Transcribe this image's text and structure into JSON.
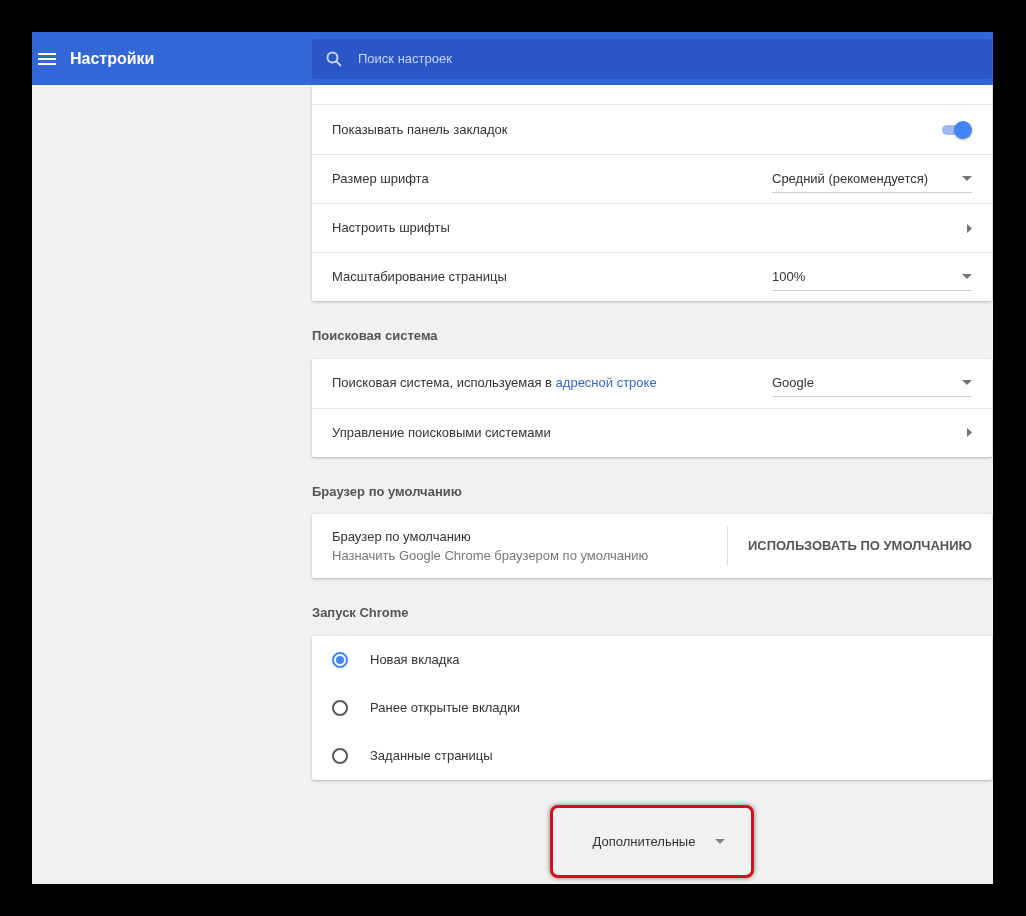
{
  "header": {
    "title": "Настройки",
    "search": {
      "placeholder": "Поиск настроек"
    }
  },
  "appearance_rows": [
    {
      "kind": "toggle",
      "label": "Показывать панель закладок",
      "on": true
    },
    {
      "kind": "select",
      "label": "Размер шрифта",
      "value": "Средний (рекомендуется)"
    },
    {
      "kind": "link",
      "label": "Настроить шрифты"
    },
    {
      "kind": "select",
      "label": "Масштабирование страницы",
      "value": "100%"
    }
  ],
  "search_engine": {
    "title": "Поисковая система",
    "rows": [
      {
        "kind": "select",
        "label": "Поисковая система, используемая в",
        "link": "адресной строке",
        "value": "Google"
      },
      {
        "kind": "link",
        "label": "Управление поисковыми системами"
      }
    ]
  },
  "default_browser": {
    "title": "Браузер по умолчанию",
    "label": "Браузер по умолчанию",
    "sublabel": "Назначить Google Chrome браузером по умолчанию",
    "button": "ИСПОЛЬЗОВАТЬ ПО УМОЛЧАНИЮ"
  },
  "startup": {
    "title": "Запуск Chrome",
    "options": [
      {
        "label": "Новая вкладка",
        "selected": true
      },
      {
        "label": "Ранее открытые вкладки",
        "selected": false
      },
      {
        "label": "Заданные страницы",
        "selected": false
      }
    ]
  },
  "advanced": {
    "label": "Дополнительные",
    "highlighted": true
  }
}
